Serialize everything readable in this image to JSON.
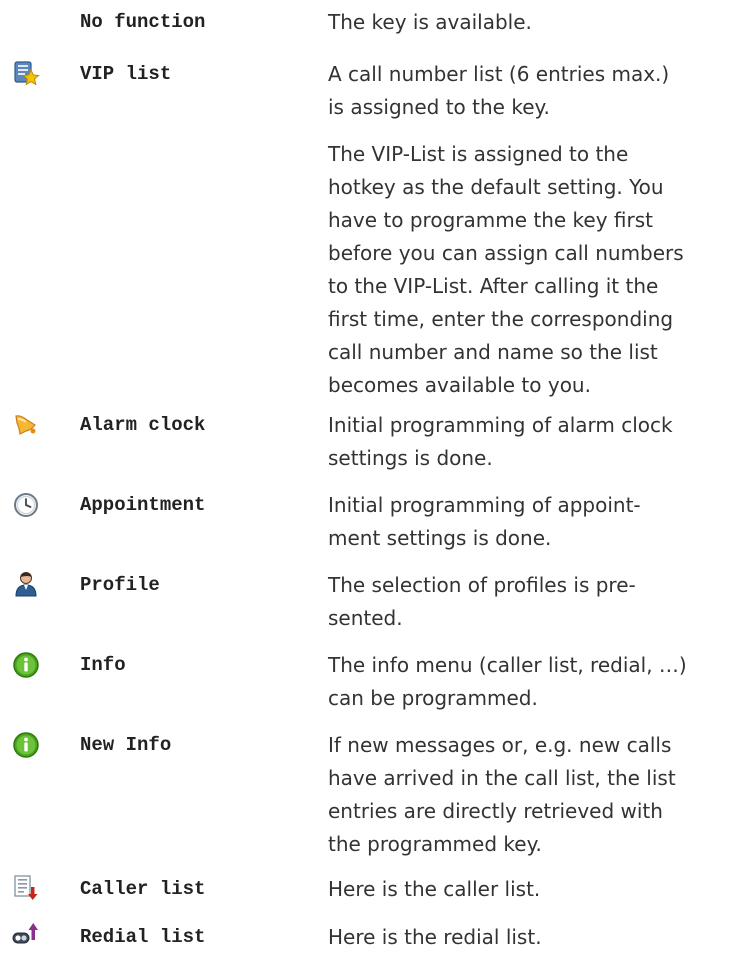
{
  "entries": [
    {
      "icon": "none",
      "name": "No function",
      "desc": [
        [
          "The key is available."
        ]
      ]
    },
    {
      "icon": "vip-list-icon",
      "name": "VIP list",
      "desc": [
        [
          "A call number list (6 entries max.)",
          "is assigned to the key."
        ],
        [
          "The VIP-List is assigned to the",
          "hotkey as the default setting. You",
          "have to programme the key first",
          "before you can assign call numbers",
          "to the VIP-List. After calling it the",
          "first time, enter the corresponding",
          "call number and name so the list",
          "becomes available to you."
        ]
      ]
    },
    {
      "icon": "alarm-bell-icon",
      "name": "Alarm clock",
      "desc": [
        [
          "Initial programming of alarm clock",
          "settings is done."
        ]
      ]
    },
    {
      "icon": "clock-icon",
      "name": "Appointment",
      "desc": [
        [
          "Initial programming of appoint-",
          "ment settings is done."
        ]
      ]
    },
    {
      "icon": "user-profile-icon",
      "name": "Profile",
      "desc": [
        [
          "The selection of profiles is pre-",
          "sented."
        ]
      ]
    },
    {
      "icon": "info-icon",
      "name": "Info",
      "desc": [
        [
          "The info menu (caller list, redial, …)",
          "can be programmed."
        ]
      ]
    },
    {
      "icon": "info-icon",
      "name": "New Info",
      "desc": [
        [
          "If new messages or, e.g. new calls",
          "have arrived in the call list, the list",
          "entries are directly retrieved with",
          "the programmed key."
        ]
      ]
    },
    {
      "icon": "caller-list-icon",
      "name": "Caller list",
      "desc": [
        [
          "Here is the caller list."
        ]
      ]
    },
    {
      "icon": "redial-list-icon",
      "name": "Redial list",
      "desc": [
        [
          "Here is the redial list."
        ]
      ]
    }
  ],
  "colors": {
    "text": "#333333",
    "name_text": "#222222",
    "info_green": "#3f9c12",
    "alarm_orange": "#f2a31a",
    "vip_blue": "#4a7bb5",
    "vip_star": "#f5c400",
    "arrow_red": "#c0281b",
    "arrow_purple": "#8a2f8a"
  }
}
